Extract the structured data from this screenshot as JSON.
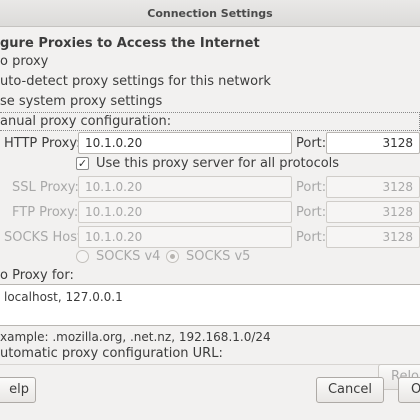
{
  "window": {
    "title": "Connection Settings"
  },
  "heading": "gure Proxies to Access the Internet",
  "options": {
    "no_proxy": "o proxy",
    "auto_detect": "uto-detect proxy settings for this network",
    "system": "se system proxy settings",
    "manual": "anual proxy configuration:"
  },
  "http": {
    "label": "HTTP Proxy:",
    "value": "10.1.0.20",
    "port_label": "Port:",
    "port": "3128"
  },
  "use_all": {
    "label": "Use this proxy server for all protocols",
    "checked": true
  },
  "ssl": {
    "label": "SSL Proxy:",
    "value": "10.1.0.20",
    "port_label": "Port:",
    "port": "3128"
  },
  "ftp": {
    "label": "FTP Proxy:",
    "value": "10.1.0.20",
    "port_label": "Port:",
    "port": "3128"
  },
  "socks": {
    "label": "SOCKS Host:",
    "value": "10.1.0.20",
    "port_label": "Port:",
    "port": "3128"
  },
  "socks_version": {
    "v4": "SOCKS v4",
    "v5": "SOCKS v5",
    "selected": "v5"
  },
  "no_proxy_for": {
    "label": "o Proxy for:",
    "value": " localhost, 127.0.0.1"
  },
  "example": "xample: .mozilla.org, .net.nz, 192.168.1.0/24",
  "auto_url": {
    "label": "utomatic proxy configuration URL:",
    "reload": "Relo"
  },
  "buttons": {
    "help": "elp",
    "cancel": "Cancel",
    "ok": "O"
  }
}
